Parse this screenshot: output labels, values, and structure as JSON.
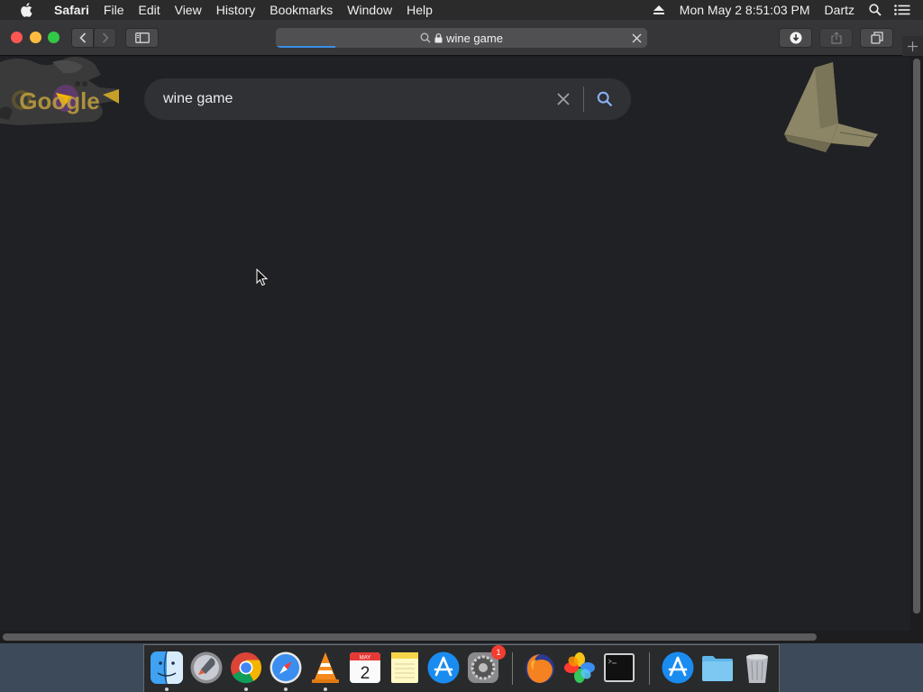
{
  "menubar": {
    "app_name": "Safari",
    "items": [
      "File",
      "Edit",
      "View",
      "History",
      "Bookmarks",
      "Window",
      "Help"
    ],
    "datetime": "Mon May 2  8:51:03 PM",
    "user": "Dartz"
  },
  "toolbar": {
    "url_text": "wine game",
    "load_progress": 0.16
  },
  "search": {
    "query": "wine game"
  },
  "doodle": {
    "logo_text": "Google"
  },
  "dock": {
    "apps": [
      "finder-icon",
      "launchpad-icon",
      "chrome-icon",
      "safari-icon",
      "vlc-icon",
      "calendar-icon",
      "notes-icon",
      "app-store-icon",
      "system-preferences-icon",
      "firefox-icon",
      "photos-icon",
      "terminal-icon",
      "app-store-folder-icon",
      "documents-folder-icon",
      "trash-icon"
    ],
    "calendar_month": "MAY",
    "calendar_day": "2",
    "prefs_badge": "1"
  },
  "colors": {
    "page_bg": "#202124",
    "searchbox_bg": "#303134",
    "accent": "#8ab4f8",
    "progress": "#3b8fe8"
  }
}
